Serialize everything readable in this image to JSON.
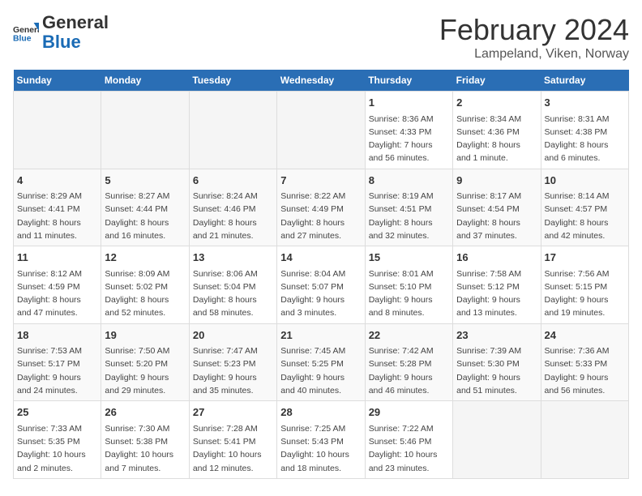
{
  "header": {
    "logo_general": "General",
    "logo_blue": "Blue",
    "title": "February 2024",
    "subtitle": "Lampeland, Viken, Norway"
  },
  "weekdays": [
    "Sunday",
    "Monday",
    "Tuesday",
    "Wednesday",
    "Thursday",
    "Friday",
    "Saturday"
  ],
  "weeks": [
    [
      {
        "day": "",
        "info": ""
      },
      {
        "day": "",
        "info": ""
      },
      {
        "day": "",
        "info": ""
      },
      {
        "day": "",
        "info": ""
      },
      {
        "day": "1",
        "info": "Sunrise: 8:36 AM\nSunset: 4:33 PM\nDaylight: 7 hours\nand 56 minutes."
      },
      {
        "day": "2",
        "info": "Sunrise: 8:34 AM\nSunset: 4:36 PM\nDaylight: 8 hours\nand 1 minute."
      },
      {
        "day": "3",
        "info": "Sunrise: 8:31 AM\nSunset: 4:38 PM\nDaylight: 8 hours\nand 6 minutes."
      }
    ],
    [
      {
        "day": "4",
        "info": "Sunrise: 8:29 AM\nSunset: 4:41 PM\nDaylight: 8 hours\nand 11 minutes."
      },
      {
        "day": "5",
        "info": "Sunrise: 8:27 AM\nSunset: 4:44 PM\nDaylight: 8 hours\nand 16 minutes."
      },
      {
        "day": "6",
        "info": "Sunrise: 8:24 AM\nSunset: 4:46 PM\nDaylight: 8 hours\nand 21 minutes."
      },
      {
        "day": "7",
        "info": "Sunrise: 8:22 AM\nSunset: 4:49 PM\nDaylight: 8 hours\nand 27 minutes."
      },
      {
        "day": "8",
        "info": "Sunrise: 8:19 AM\nSunset: 4:51 PM\nDaylight: 8 hours\nand 32 minutes."
      },
      {
        "day": "9",
        "info": "Sunrise: 8:17 AM\nSunset: 4:54 PM\nDaylight: 8 hours\nand 37 minutes."
      },
      {
        "day": "10",
        "info": "Sunrise: 8:14 AM\nSunset: 4:57 PM\nDaylight: 8 hours\nand 42 minutes."
      }
    ],
    [
      {
        "day": "11",
        "info": "Sunrise: 8:12 AM\nSunset: 4:59 PM\nDaylight: 8 hours\nand 47 minutes."
      },
      {
        "day": "12",
        "info": "Sunrise: 8:09 AM\nSunset: 5:02 PM\nDaylight: 8 hours\nand 52 minutes."
      },
      {
        "day": "13",
        "info": "Sunrise: 8:06 AM\nSunset: 5:04 PM\nDaylight: 8 hours\nand 58 minutes."
      },
      {
        "day": "14",
        "info": "Sunrise: 8:04 AM\nSunset: 5:07 PM\nDaylight: 9 hours\nand 3 minutes."
      },
      {
        "day": "15",
        "info": "Sunrise: 8:01 AM\nSunset: 5:10 PM\nDaylight: 9 hours\nand 8 minutes."
      },
      {
        "day": "16",
        "info": "Sunrise: 7:58 AM\nSunset: 5:12 PM\nDaylight: 9 hours\nand 13 minutes."
      },
      {
        "day": "17",
        "info": "Sunrise: 7:56 AM\nSunset: 5:15 PM\nDaylight: 9 hours\nand 19 minutes."
      }
    ],
    [
      {
        "day": "18",
        "info": "Sunrise: 7:53 AM\nSunset: 5:17 PM\nDaylight: 9 hours\nand 24 minutes."
      },
      {
        "day": "19",
        "info": "Sunrise: 7:50 AM\nSunset: 5:20 PM\nDaylight: 9 hours\nand 29 minutes."
      },
      {
        "day": "20",
        "info": "Sunrise: 7:47 AM\nSunset: 5:23 PM\nDaylight: 9 hours\nand 35 minutes."
      },
      {
        "day": "21",
        "info": "Sunrise: 7:45 AM\nSunset: 5:25 PM\nDaylight: 9 hours\nand 40 minutes."
      },
      {
        "day": "22",
        "info": "Sunrise: 7:42 AM\nSunset: 5:28 PM\nDaylight: 9 hours\nand 46 minutes."
      },
      {
        "day": "23",
        "info": "Sunrise: 7:39 AM\nSunset: 5:30 PM\nDaylight: 9 hours\nand 51 minutes."
      },
      {
        "day": "24",
        "info": "Sunrise: 7:36 AM\nSunset: 5:33 PM\nDaylight: 9 hours\nand 56 minutes."
      }
    ],
    [
      {
        "day": "25",
        "info": "Sunrise: 7:33 AM\nSunset: 5:35 PM\nDaylight: 10 hours\nand 2 minutes."
      },
      {
        "day": "26",
        "info": "Sunrise: 7:30 AM\nSunset: 5:38 PM\nDaylight: 10 hours\nand 7 minutes."
      },
      {
        "day": "27",
        "info": "Sunrise: 7:28 AM\nSunset: 5:41 PM\nDaylight: 10 hours\nand 12 minutes."
      },
      {
        "day": "28",
        "info": "Sunrise: 7:25 AM\nSunset: 5:43 PM\nDaylight: 10 hours\nand 18 minutes."
      },
      {
        "day": "29",
        "info": "Sunrise: 7:22 AM\nSunset: 5:46 PM\nDaylight: 10 hours\nand 23 minutes."
      },
      {
        "day": "",
        "info": ""
      },
      {
        "day": "",
        "info": ""
      }
    ]
  ]
}
